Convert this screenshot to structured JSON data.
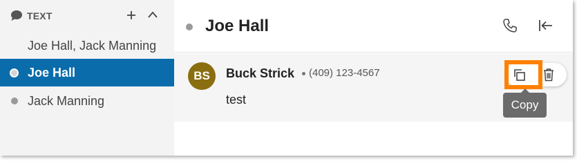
{
  "sidebar": {
    "section_title": "TEXT",
    "conversations": [
      {
        "label": "Joe Hall, Jack Manning",
        "active": false,
        "presence": "none"
      },
      {
        "label": "Joe Hall",
        "active": true,
        "presence": "ring"
      },
      {
        "label": "Jack Manning",
        "active": false,
        "presence": "dot"
      }
    ]
  },
  "header": {
    "title": "Joe Hall"
  },
  "message": {
    "avatar_initials": "BS",
    "sender": "Buck Strick",
    "phone": "(409) 123-4567",
    "text": "test"
  },
  "tooltip": {
    "label": "Copy"
  },
  "colors": {
    "active_item": "#0a6cab",
    "avatar": "#8a6e10",
    "highlight": "#ff8000",
    "tooltip": "#6b6b6b"
  },
  "icons": [
    "chat-icon",
    "plus-icon",
    "chevron-up-icon",
    "phone-icon",
    "collapse-panel-icon",
    "copy-icon",
    "trash-icon"
  ]
}
